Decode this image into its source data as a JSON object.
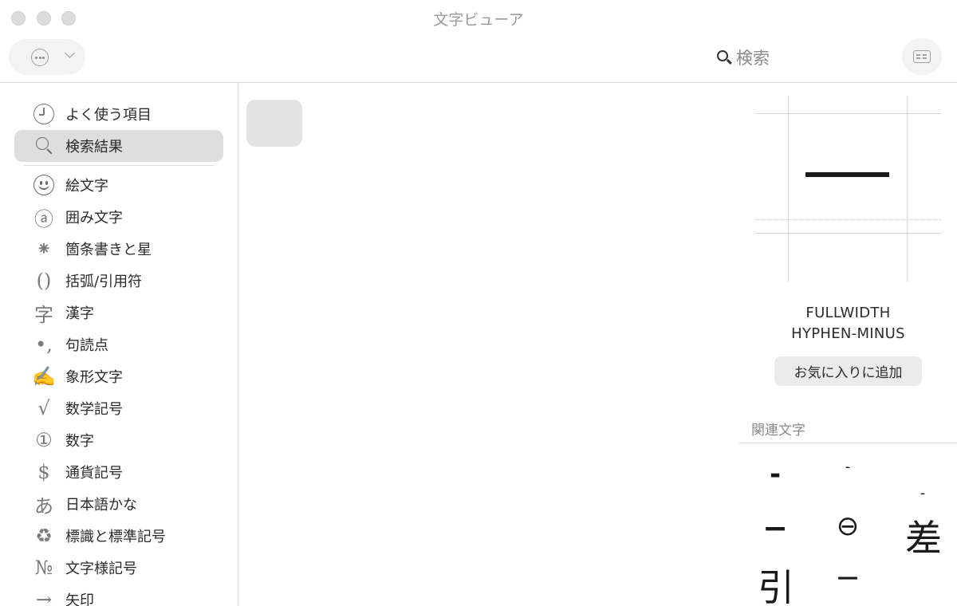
{
  "window": {
    "title": "文字ビューア"
  },
  "toolbar": {
    "search_label": "検索"
  },
  "sidebar": {
    "items": [
      {
        "label": "よく使う項目",
        "icon": "clock-icon"
      },
      {
        "label": "検索結果",
        "icon": "search-icon",
        "selected": true
      },
      {
        "label": "絵文字",
        "icon": "smiley-icon"
      },
      {
        "label": "囲み文字",
        "icon": "circled-a-icon",
        "glyph": "ⓐ"
      },
      {
        "label": "箇条書きと星",
        "icon": "asterisk-icon",
        "glyph": "⁕"
      },
      {
        "label": "括弧/引用符",
        "icon": "parentheses-icon",
        "glyph": "()"
      },
      {
        "label": "漢字",
        "icon": "kanji-icon",
        "glyph": "字"
      },
      {
        "label": "句読点",
        "icon": "punctuation-icon",
        "glyph": "•,"
      },
      {
        "label": "象形文字",
        "icon": "pictograph-icon",
        "glyph": "✍"
      },
      {
        "label": "数学記号",
        "icon": "square-root-icon",
        "glyph": "√"
      },
      {
        "label": "数字",
        "icon": "circled-one-icon",
        "glyph": "①"
      },
      {
        "label": "通貨記号",
        "icon": "dollar-icon",
        "glyph": "$"
      },
      {
        "label": "日本語かな",
        "icon": "hiragana-a-icon",
        "glyph": "あ"
      },
      {
        "label": "標識と標準記号",
        "icon": "recycle-icon",
        "glyph": "♻"
      },
      {
        "label": "文字様記号",
        "icon": "numero-icon",
        "glyph": "№"
      },
      {
        "label": "矢印",
        "icon": "arrow-icon",
        "glyph": "→"
      }
    ]
  },
  "inspector": {
    "character_name": "FULLWIDTH\nHYPHEN-MINUS",
    "character_name_line1": "FULLWIDTH",
    "character_name_line2": "HYPHEN-MINUS",
    "favorite_button": "お気に入りに追加",
    "related_label": "関連文字",
    "related_chars": [
      "-",
      "-",
      "-",
      "−",
      "⊖",
      "差",
      "引",
      "−"
    ]
  },
  "colors": {
    "selected_bg": "#dedede",
    "divider": "#dcdcdc",
    "muted_text": "#8a8a8a"
  }
}
